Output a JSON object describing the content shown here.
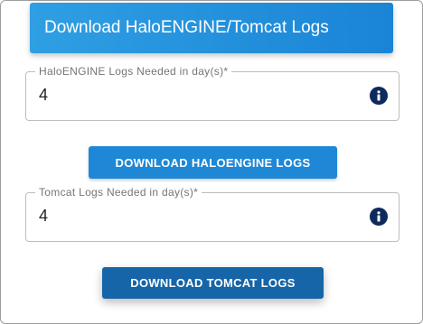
{
  "header": {
    "title": "Download HaloENGINE/Tomcat Logs"
  },
  "haloengine": {
    "field_label": "HaloENGINE Logs Needed in day(s)*",
    "field_value": "4",
    "button_label": "DOWNLOAD HALOENGINE LOGS"
  },
  "tomcat": {
    "field_label": "Tomcat Logs Needed in day(s)*",
    "field_value": "4",
    "button_label": "DOWNLOAD TOMCAT LOGS"
  },
  "icons": {
    "info": "info-icon"
  },
  "colors": {
    "header_start": "#2f9fe3",
    "header_end": "#1a84d6",
    "button_halo": "#1e88d6",
    "button_tomcat": "#1565a8",
    "info_icon": "#0d2a5c"
  }
}
